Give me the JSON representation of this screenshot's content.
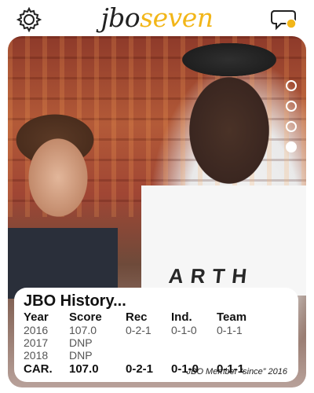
{
  "app": {
    "logo_part1": "jbo",
    "logo_part2": "seven"
  },
  "icons": {
    "settings": "gear-icon",
    "chat": "chat-bubble-icon",
    "notification_color": "#f2b619"
  },
  "gallery": {
    "total_pages": 4,
    "active_index": 4
  },
  "photo": {
    "shirt_text": "ARTH"
  },
  "history": {
    "title": "JBO History...",
    "columns": [
      "Year",
      "Score",
      "Rec",
      "Ind.",
      "Team"
    ],
    "rows": [
      [
        "2016",
        "107.0",
        "0-2-1",
        "0-1-0",
        "0-1-1"
      ],
      [
        "2017",
        "DNP",
        "",
        "",
        ""
      ],
      [
        "2018",
        "DNP",
        "",
        "",
        ""
      ]
    ],
    "career": [
      "CAR.",
      "107.0",
      "0-2-1",
      "0-1-0",
      "0-1-1"
    ],
    "member_since": "JBO Member “since” 2016"
  },
  "colors": {
    "brand": "#f2b619",
    "text": "#111111"
  }
}
